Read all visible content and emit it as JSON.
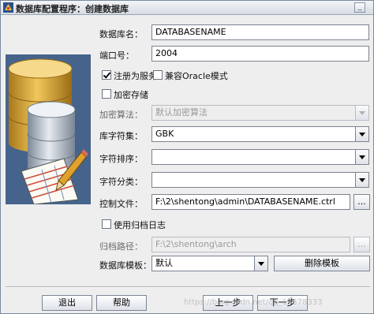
{
  "window": {
    "title": "数据库配置程序：创建数据库",
    "minimize_label": "_"
  },
  "form": {
    "db_name": {
      "label": "数据库名：",
      "value": "DATABASENAME"
    },
    "port": {
      "label": "端口号：",
      "value": "2004"
    },
    "register_service": {
      "label": "注册为服务",
      "checked": true
    },
    "oracle_compat": {
      "label": "兼容Oracle模式",
      "checked": false
    },
    "encrypt_storage": {
      "label": "加密存储",
      "checked": false
    },
    "encrypt_algo": {
      "label": "加密算法：",
      "value": "默认加密算法",
      "enabled": false
    },
    "charset": {
      "label": "库字符集：",
      "value": "GBK"
    },
    "collation": {
      "label": "字符排序：",
      "value": ""
    },
    "char_class": {
      "label": "字符分类：",
      "value": ""
    },
    "control_file": {
      "label": "控制文件：",
      "value": "F:\\2\\shentong\\admin\\DATABASENAME.ctrl",
      "browse_label": "..."
    },
    "archive_log": {
      "label": "使用归档日志",
      "checked": false
    },
    "archive_path": {
      "label": "归档路径：",
      "value": "F:\\2\\shentong\\arch",
      "browse_label": "...",
      "enabled": false
    },
    "template": {
      "label": "数据库模板：",
      "value": "默认",
      "delete_label": "删除模板"
    }
  },
  "footer": {
    "exit_label": "退出",
    "help_label": "帮助",
    "prev_label": "上一步",
    "next_label": "下一步",
    "watermark": "https://blog.csdn.net/qq_17578333"
  },
  "colors": {
    "illustration_bg": "#3f5d83",
    "db_gold": "#d9a83a",
    "db_silver": "#b9c2cc"
  }
}
